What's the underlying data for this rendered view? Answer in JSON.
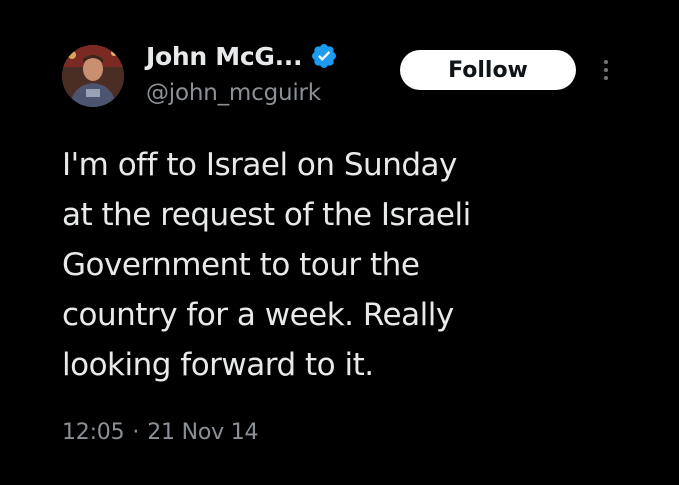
{
  "tweet": {
    "author": {
      "display_name": "John McG...",
      "handle": "@john_mcguirk",
      "verified": true,
      "avatar_icon": "profile-photo"
    },
    "follow_label": "Follow",
    "more_icon": "more-options-icon",
    "text_lines": [
      "I'm off to Israel on Sunday",
      "at the request of the Israeli",
      "Government to tour the",
      "country for a week. Really",
      "looking forward to it."
    ],
    "time": "12:05",
    "separator": "·",
    "date": "21 Nov 14"
  },
  "colors": {
    "background": "#000000",
    "text_primary": "#e7e9ea",
    "text_secondary": "#8b9096",
    "verified_badge": "#1d9bf0",
    "follow_bg": "#ffffff",
    "follow_text": "#0f1419"
  }
}
